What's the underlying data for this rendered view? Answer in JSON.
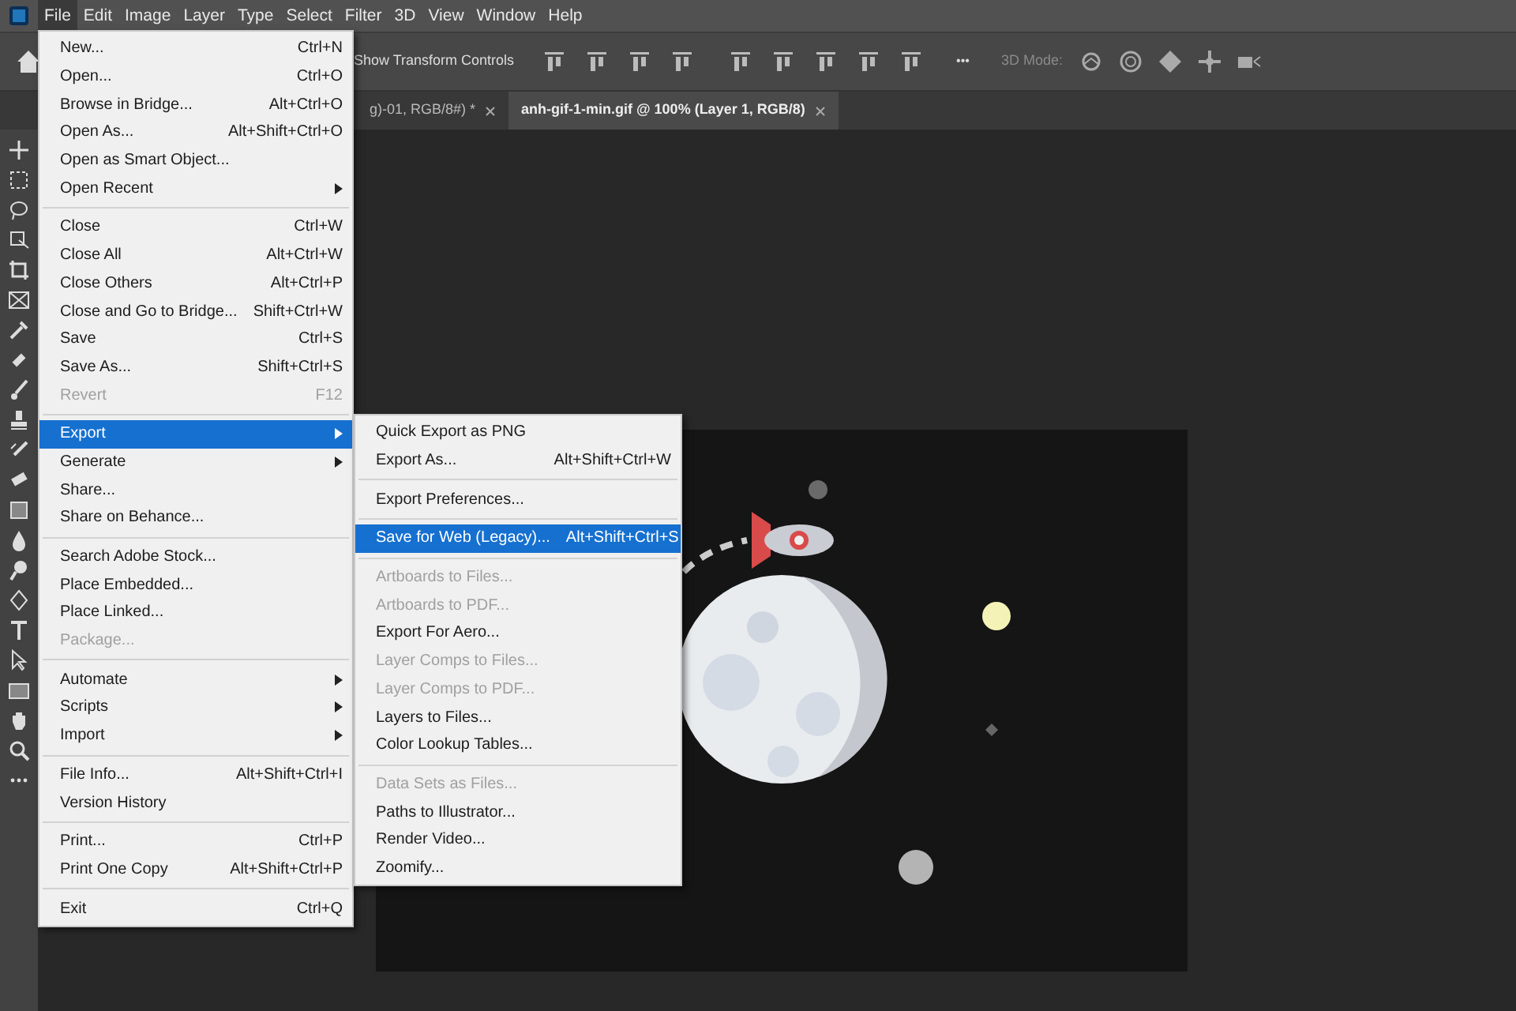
{
  "menu_bar": {
    "items": [
      {
        "label": "File",
        "selected": true
      },
      {
        "label": "Edit",
        "selected": false
      },
      {
        "label": "Image",
        "selected": false
      },
      {
        "label": "Layer",
        "selected": false
      },
      {
        "label": "Type",
        "selected": false
      },
      {
        "label": "Select",
        "selected": false
      },
      {
        "label": "Filter",
        "selected": false
      },
      {
        "label": "3D",
        "selected": false
      },
      {
        "label": "View",
        "selected": false
      },
      {
        "label": "Window",
        "selected": false
      },
      {
        "label": "Help",
        "selected": false
      }
    ]
  },
  "options_bar": {
    "transform_label": "Show Transform Controls",
    "more": "•••",
    "mode_label": "3D Mode:"
  },
  "tabs": [
    {
      "label": "g)-01, RGB/8#) *",
      "selected": false
    },
    {
      "label": "anh-gif-1-min.gif @ 100% (Layer 1, RGB/8)",
      "selected": true
    }
  ],
  "file_menu": {
    "sections": [
      [
        {
          "label": "New...",
          "shortcut": "Ctrl+N",
          "disabled": false,
          "submenu": false,
          "selected": false
        },
        {
          "label": "Open...",
          "shortcut": "Ctrl+O",
          "disabled": false,
          "submenu": false,
          "selected": false
        },
        {
          "label": "Browse in Bridge...",
          "shortcut": "Alt+Ctrl+O",
          "disabled": false,
          "submenu": false,
          "selected": false
        },
        {
          "label": "Open As...",
          "shortcut": "Alt+Shift+Ctrl+O",
          "disabled": false,
          "submenu": false,
          "selected": false
        },
        {
          "label": "Open as Smart Object...",
          "disabled": false,
          "submenu": false,
          "selected": false
        },
        {
          "label": "Open Recent",
          "disabled": false,
          "submenu": true,
          "selected": false
        }
      ],
      [
        {
          "label": "Close",
          "shortcut": "Ctrl+W",
          "disabled": false,
          "submenu": false,
          "selected": false
        },
        {
          "label": "Close All",
          "shortcut": "Alt+Ctrl+W",
          "disabled": false,
          "submenu": false,
          "selected": false
        },
        {
          "label": "Close Others",
          "shortcut": "Alt+Ctrl+P",
          "disabled": false,
          "submenu": false,
          "selected": false
        },
        {
          "label": "Close and Go to Bridge...",
          "shortcut": "Shift+Ctrl+W",
          "disabled": false,
          "submenu": false,
          "selected": false
        },
        {
          "label": "Save",
          "shortcut": "Ctrl+S",
          "disabled": false,
          "submenu": false,
          "selected": false
        },
        {
          "label": "Save As...",
          "shortcut": "Shift+Ctrl+S",
          "disabled": false,
          "submenu": false,
          "selected": false
        },
        {
          "label": "Revert",
          "shortcut": "F12",
          "disabled": true,
          "submenu": false,
          "selected": false
        }
      ],
      [
        {
          "label": "Export",
          "disabled": false,
          "submenu": true,
          "selected": true
        },
        {
          "label": "Generate",
          "disabled": false,
          "submenu": true,
          "selected": false
        },
        {
          "label": "Share...",
          "disabled": false,
          "submenu": false,
          "selected": false
        },
        {
          "label": "Share on Behance...",
          "disabled": false,
          "submenu": false,
          "selected": false
        }
      ],
      [
        {
          "label": "Search Adobe Stock...",
          "disabled": false,
          "submenu": false,
          "selected": false
        },
        {
          "label": "Place Embedded...",
          "disabled": false,
          "submenu": false,
          "selected": false
        },
        {
          "label": "Place Linked...",
          "disabled": false,
          "submenu": false,
          "selected": false
        },
        {
          "label": "Package...",
          "disabled": true,
          "submenu": false,
          "selected": false
        }
      ],
      [
        {
          "label": "Automate",
          "disabled": false,
          "submenu": true,
          "selected": false
        },
        {
          "label": "Scripts",
          "disabled": false,
          "submenu": true,
          "selected": false
        },
        {
          "label": "Import",
          "disabled": false,
          "submenu": true,
          "selected": false
        }
      ],
      [
        {
          "label": "File Info...",
          "shortcut": "Alt+Shift+Ctrl+I",
          "disabled": false,
          "submenu": false,
          "selected": false
        },
        {
          "label": "Version History",
          "disabled": false,
          "submenu": false,
          "selected": false
        }
      ],
      [
        {
          "label": "Print...",
          "shortcut": "Ctrl+P",
          "disabled": false,
          "submenu": false,
          "selected": false
        },
        {
          "label": "Print One Copy",
          "shortcut": "Alt+Shift+Ctrl+P",
          "disabled": false,
          "submenu": false,
          "selected": false
        }
      ],
      [
        {
          "label": "Exit",
          "shortcut": "Ctrl+Q",
          "disabled": false,
          "submenu": false,
          "selected": false
        }
      ]
    ]
  },
  "export_menu": {
    "sections": [
      [
        {
          "label": "Quick Export as PNG",
          "disabled": false,
          "submenu": false,
          "selected": false
        },
        {
          "label": "Export As...",
          "shortcut": "Alt+Shift+Ctrl+W",
          "disabled": false,
          "submenu": false,
          "selected": false
        }
      ],
      [
        {
          "label": "Export Preferences...",
          "disabled": false,
          "submenu": false,
          "selected": false
        }
      ],
      [
        {
          "label": "Save for Web (Legacy)...",
          "shortcut": "Alt+Shift+Ctrl+S",
          "disabled": false,
          "submenu": false,
          "selected": true
        }
      ],
      [
        {
          "label": "Artboards to Files...",
          "disabled": true,
          "submenu": false,
          "selected": false
        },
        {
          "label": "Artboards to PDF...",
          "disabled": true,
          "submenu": false,
          "selected": false
        },
        {
          "label": "Export For Aero...",
          "disabled": false,
          "submenu": false,
          "selected": false
        },
        {
          "label": "Layer Comps to Files...",
          "disabled": true,
          "submenu": false,
          "selected": false
        },
        {
          "label": "Layer Comps to PDF...",
          "disabled": true,
          "submenu": false,
          "selected": false
        },
        {
          "label": "Layers to Files...",
          "disabled": false,
          "submenu": false,
          "selected": false
        },
        {
          "label": "Color Lookup Tables...",
          "disabled": false,
          "submenu": false,
          "selected": false
        }
      ],
      [
        {
          "label": "Data Sets as Files...",
          "disabled": true,
          "submenu": false,
          "selected": false
        },
        {
          "label": "Paths to Illustrator...",
          "disabled": false,
          "submenu": false,
          "selected": false
        },
        {
          "label": "Render Video...",
          "disabled": false,
          "submenu": false,
          "selected": false
        },
        {
          "label": "Zoomify...",
          "disabled": false,
          "submenu": false,
          "selected": false
        }
      ]
    ]
  }
}
